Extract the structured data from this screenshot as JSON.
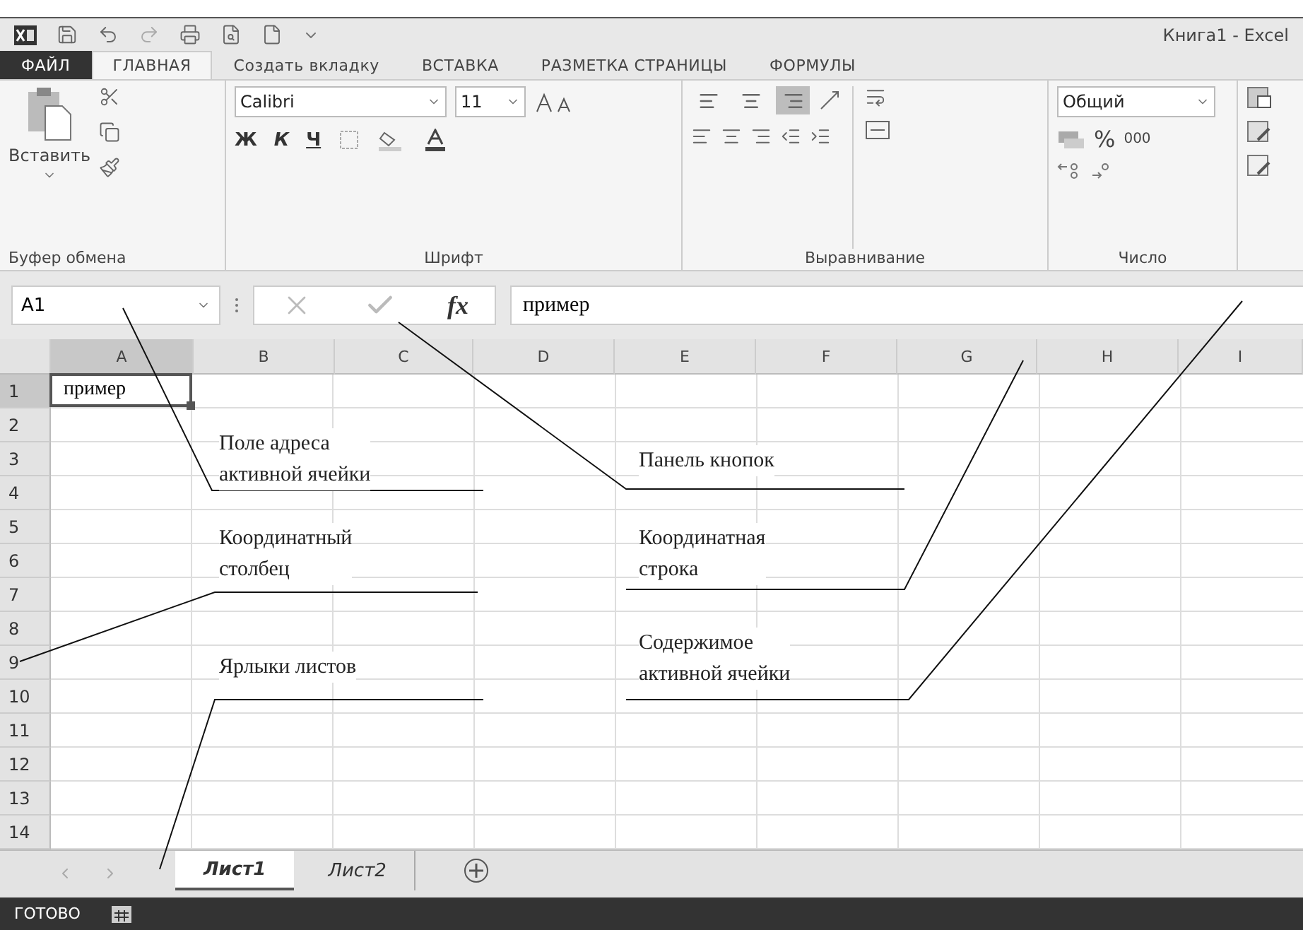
{
  "window": {
    "title": "Книга1 - Excel"
  },
  "tabs": [
    {
      "label": "ФАЙЛ",
      "kind": "file",
      "selected": false
    },
    {
      "label": "ГЛАВНАЯ",
      "kind": "tab",
      "selected": true
    },
    {
      "label": "Создать вкладку",
      "kind": "tab",
      "selected": false
    },
    {
      "label": "ВСТАВКА",
      "kind": "tab",
      "selected": false
    },
    {
      "label": "РАЗМЕТКА СТРАНИЦЫ",
      "kind": "tab",
      "selected": false
    },
    {
      "label": "ФОРМУЛЫ",
      "kind": "tab",
      "selected": false
    }
  ],
  "ribbon": {
    "clipboard": {
      "paste": "Вставить",
      "label": "Буфер обмена"
    },
    "font": {
      "name": "Calibri",
      "size": "11",
      "bold": "Ж",
      "italic": "К",
      "underline": "Ч",
      "label": "Шрифт"
    },
    "alignment": {
      "vertical": [
        {
          "kind": "top",
          "selected": false
        },
        {
          "kind": "middle",
          "selected": false
        },
        {
          "kind": "bottom",
          "selected": true
        }
      ],
      "label": "Выравнивание"
    },
    "number": {
      "format": "Общий",
      "percent": "%",
      "thousands": "000",
      "label": "Число"
    }
  },
  "formula_bar": {
    "name_box": "A1",
    "fx": "fx",
    "value": "пример"
  },
  "columns": [
    {
      "label": "A",
      "selected": true
    },
    {
      "label": "B",
      "selected": false
    },
    {
      "label": "C",
      "selected": false
    },
    {
      "label": "D",
      "selected": false
    },
    {
      "label": "E",
      "selected": false
    },
    {
      "label": "F",
      "selected": false
    },
    {
      "label": "G",
      "selected": false
    },
    {
      "label": "H",
      "selected": false
    },
    {
      "label": "I",
      "selected": false
    }
  ],
  "rows": [
    {
      "label": "1",
      "selected": true
    },
    {
      "label": "2",
      "selected": false
    },
    {
      "label": "3",
      "selected": false
    },
    {
      "label": "4",
      "selected": false
    },
    {
      "label": "5",
      "selected": false
    },
    {
      "label": "6",
      "selected": false
    },
    {
      "label": "7",
      "selected": false
    },
    {
      "label": "8",
      "selected": false
    },
    {
      "label": "9",
      "selected": false
    },
    {
      "label": "10",
      "selected": false
    },
    {
      "label": "11",
      "selected": false
    },
    {
      "label": "12",
      "selected": false
    },
    {
      "label": "13",
      "selected": false
    },
    {
      "label": "14",
      "selected": false
    }
  ],
  "active_cell": {
    "value": "пример"
  },
  "sheet_tabs": [
    {
      "label": "Лист1",
      "selected": true
    },
    {
      "label": "Лист2",
      "selected": false
    }
  ],
  "status_bar": {
    "text": "ГОТОВО"
  },
  "annotations": [
    {
      "lines": [
        "Поле адреса",
        "активной ячейки"
      ]
    },
    {
      "lines": [
        "Координатный",
        "столбец"
      ]
    },
    {
      "lines": [
        "Ярлыки листов"
      ]
    },
    {
      "lines": [
        "Панель кнопок"
      ]
    },
    {
      "lines": [
        "Координатная",
        "строка"
      ]
    },
    {
      "lines": [
        "Содержимое",
        "активной ячейки"
      ]
    }
  ]
}
